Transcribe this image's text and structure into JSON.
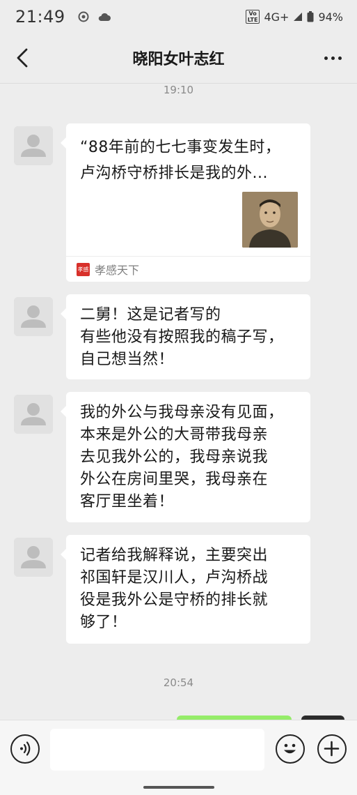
{
  "status_bar": {
    "time": "21:49",
    "network": "4G+",
    "volte_label": "Vo\nLTE",
    "battery": "94%"
  },
  "nav": {
    "title": "晓阳女叶志红",
    "back_icon": "back-chevron-icon",
    "more_icon": "more-dots-icon"
  },
  "chat": {
    "timestamp_1": "19:10",
    "card": {
      "title_line1": "“88年前的七七事变发生时，",
      "title_line2": "卢沟桥守桥排长是我的外...",
      "source_logo": "孝感",
      "source_name": "孝感天下"
    },
    "messages": [
      {
        "lines": [
          "二舅！这是记者写的",
          "有些他没有按照我的稿子写，",
          "自己想当然！"
        ]
      },
      {
        "lines": [
          "我的外公与我母亲没有见面，",
          "本来是外公的大哥带我母亲",
          "去见我外公的，我母亲说我",
          "外公在房间里哭，我母亲在",
          "客厅里坐着！"
        ]
      },
      {
        "lines": [
          "记者给我解释说，主要突出",
          "祁国轩是汉川人，卢沟桥战",
          "役是我外公是守桥的排长就",
          "够了！"
        ]
      }
    ],
    "timestamp_2": "20:54"
  },
  "input_bar": {
    "voice_icon": "voice-icon",
    "emoji_icon": "emoji-icon",
    "plus_icon": "plus-icon",
    "input_value": ""
  },
  "colors": {
    "background": "#ededed",
    "bubble": "#ffffff",
    "self_bubble": "#95ec69",
    "source_logo": "#d8302a"
  }
}
